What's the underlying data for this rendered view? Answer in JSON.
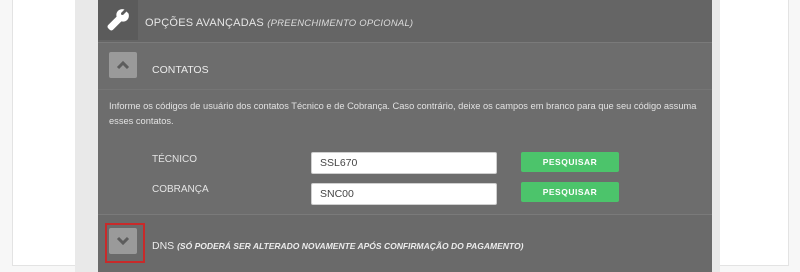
{
  "header": {
    "title": "OPÇÕES AVANÇADAS",
    "subtitle": "(PREENCHIMENTO OPCIONAL)",
    "icon": "wrench-icon"
  },
  "contatos": {
    "label": "CONTATOS",
    "toggle_icon": "chevron-up-icon",
    "info": "Informe os códigos de usuário dos contatos Técnico e de Cobrança. Caso contrário, deixe os campos em branco para que seu código assuma esses contatos.",
    "fields": [
      {
        "label": "TÉCNICO",
        "value": "SSL670",
        "button": "PESQUISAR"
      },
      {
        "label": "COBRANÇA",
        "value": "SNC00",
        "button": "PESQUISAR"
      }
    ]
  },
  "dns": {
    "label": "DNS",
    "note": "(SÓ PODERÁ SER ALTERADO NOVAMENTE APÓS CONFIRMAÇÃO DO PAGAMENTO)",
    "toggle_icon": "chevron-down-icon"
  },
  "colors": {
    "panel": "#6d6d6d",
    "button_green": "#4cc46b",
    "highlight_red": "#c82a2a"
  }
}
